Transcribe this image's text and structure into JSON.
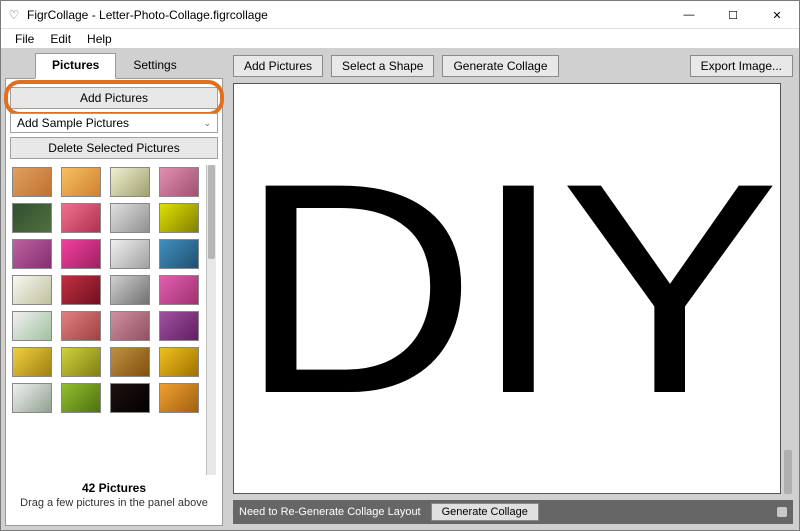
{
  "window": {
    "title": "FigrCollage - Letter-Photo-Collage.figrcollage",
    "icon": "♡"
  },
  "menu": {
    "file": "File",
    "edit": "Edit",
    "help": "Help"
  },
  "tabs": {
    "pictures": "Pictures",
    "settings": "Settings"
  },
  "sidebar": {
    "add_pictures": "Add Pictures",
    "add_sample": "Add Sample Pictures",
    "delete_selected": "Delete Selected Pictures",
    "count_label": "42 Pictures",
    "hint": "Drag a few pictures in the panel above"
  },
  "toolbar": {
    "add_pictures": "Add Pictures",
    "select_shape": "Select a Shape",
    "generate": "Generate Collage",
    "export": "Export Image..."
  },
  "canvas": {
    "shape_text": "DIY"
  },
  "statusbar": {
    "message": "Need to Re-Generate Collage Layout",
    "button": "Generate Collage"
  },
  "wincontrols": {
    "min": "—",
    "max": "☐",
    "close": "✕"
  }
}
